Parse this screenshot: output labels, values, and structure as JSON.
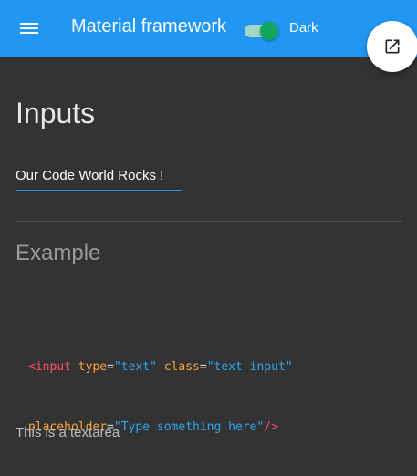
{
  "appbar": {
    "title": "Material framework",
    "theme_toggle": {
      "label": "Dark",
      "checked": true
    },
    "fab_icon": "open-in-new-icon"
  },
  "main": {
    "heading": "Inputs",
    "text_input": {
      "value": "Our Code World Rocks !"
    },
    "example_heading": "Example",
    "code": {
      "line1": [
        {
          "kind": "tag",
          "text": "<input"
        },
        {
          "kind": "plain",
          "text": " "
        },
        {
          "kind": "attr",
          "text": "type"
        },
        {
          "kind": "punc",
          "text": "="
        },
        {
          "kind": "str",
          "text": "\"text\""
        },
        {
          "kind": "plain",
          "text": " "
        },
        {
          "kind": "attr",
          "text": "class"
        },
        {
          "kind": "punc",
          "text": "="
        },
        {
          "kind": "str",
          "text": "\"text-input\""
        }
      ],
      "line2": [
        {
          "kind": "attr",
          "text": "placeholder"
        },
        {
          "kind": "punc",
          "text": "="
        },
        {
          "kind": "str",
          "text": "\"Type something here\""
        },
        {
          "kind": "tag",
          "text": "/>"
        }
      ]
    },
    "textarea": {
      "placeholder": "This is a textarea"
    }
  },
  "colors": {
    "primary": "#2196F3",
    "background": "#333333",
    "toggle_on": "#12a65a"
  }
}
